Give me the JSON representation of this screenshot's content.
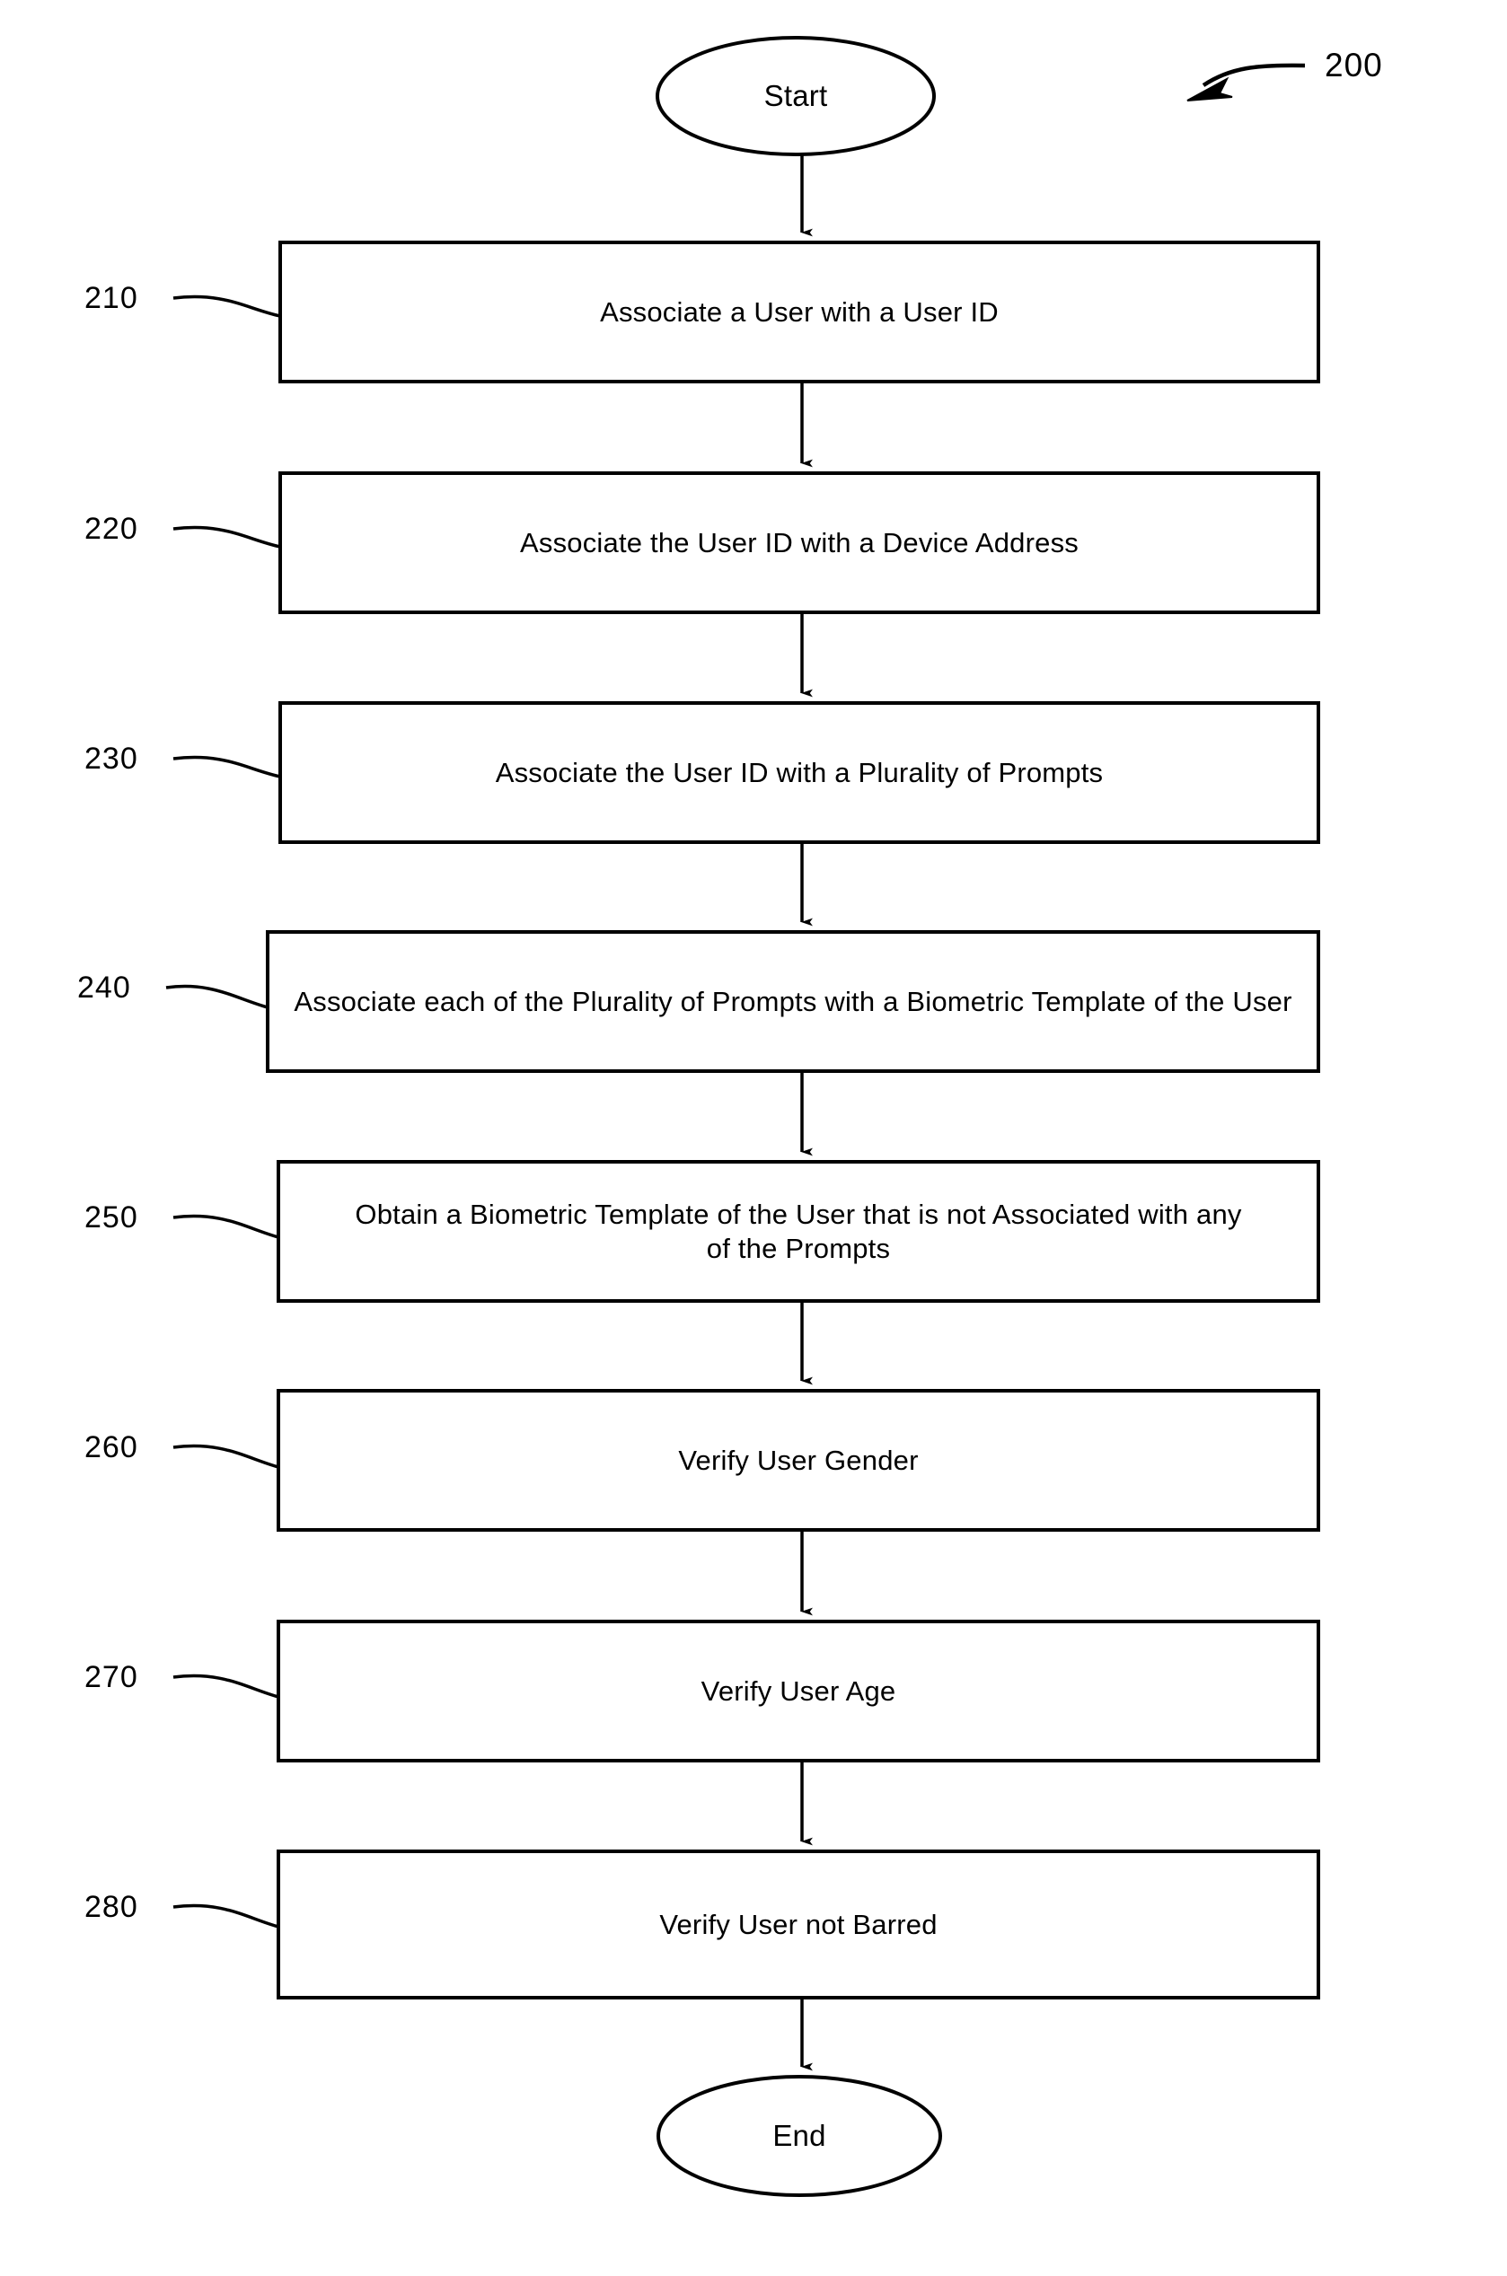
{
  "figure": {
    "reference_numeral": "200"
  },
  "terminals": {
    "start": "Start",
    "end": "End"
  },
  "steps": [
    {
      "ref": "210",
      "text": "Associate a User with a User ID"
    },
    {
      "ref": "220",
      "text": "Associate the User ID with a Device Address"
    },
    {
      "ref": "230",
      "text": "Associate the User ID with a Plurality of Prompts"
    },
    {
      "ref": "240",
      "text": "Associate each of the Plurality of Prompts with a Biometric Template of the User"
    },
    {
      "ref": "250",
      "text": "Obtain a Biometric Template of the User that is not Associated with any of the Prompts"
    },
    {
      "ref": "260",
      "text": "Verify User Gender"
    },
    {
      "ref": "270",
      "text": "Verify User Age"
    },
    {
      "ref": "280",
      "text": "Verify User not Barred"
    }
  ],
  "colors": {
    "stroke": "#000000",
    "background": "#ffffff"
  }
}
